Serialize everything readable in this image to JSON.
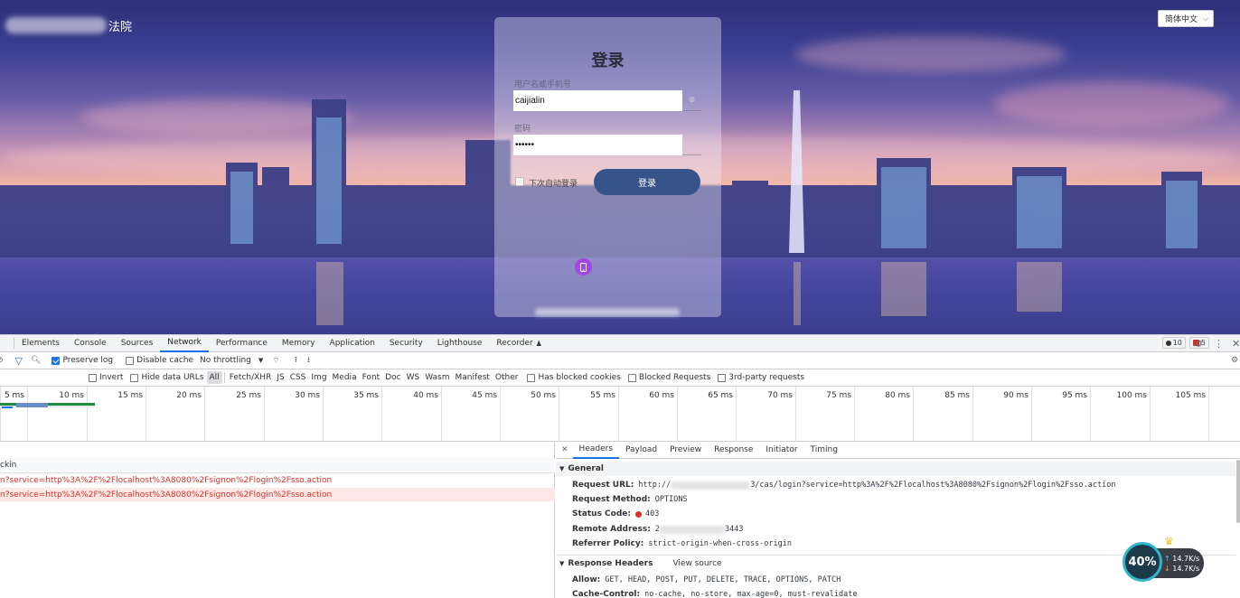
{
  "login_page": {
    "brand_text": "法院",
    "language": "简体中文",
    "title": "登录",
    "username_label": "用户名或手机号",
    "username_value": "caijialin",
    "password_label": "密码",
    "password_value": "••••••",
    "remember_label": "下次自动登录",
    "login_button": "登录",
    "phone_icon": "mobile-phone-icon"
  },
  "devtools": {
    "tabs": [
      "Elements",
      "Console",
      "Sources",
      "Network",
      "Performance",
      "Memory",
      "Application",
      "Security",
      "Lighthouse",
      "Recorder"
    ],
    "active_tab": "Network",
    "message_count": "10",
    "error_count": "5",
    "toolbar": {
      "preserve_log": "Preserve log",
      "disable_cache": "Disable cache",
      "throttling": "No throttling"
    },
    "filters": {
      "invert": "Invert",
      "hide_data_urls": "Hide data URLs",
      "types": [
        "All",
        "Fetch/XHR",
        "JS",
        "CSS",
        "Img",
        "Media",
        "Font",
        "Doc",
        "WS",
        "Wasm",
        "Manifest",
        "Other"
      ],
      "has_blocked_cookies": "Has blocked cookies",
      "blocked_requests": "Blocked Requests",
      "third_party": "3rd-party requests"
    },
    "timeline_ticks": [
      "5 ms",
      "10 ms",
      "15 ms",
      "20 ms",
      "25 ms",
      "30 ms",
      "35 ms",
      "40 ms",
      "45 ms",
      "50 ms",
      "55 ms",
      "60 ms",
      "65 ms",
      "70 ms",
      "75 ms",
      "80 ms",
      "85 ms",
      "90 ms",
      "95 ms",
      "100 ms",
      "105 ms"
    ],
    "list": {
      "header": "ckin",
      "rows": [
        "n?service=http%3A%2F%2Flocalhost%3A8080%2Fsignon%2Flogin%2Fsso.action",
        "n?service=http%3A%2F%2Flocalhost%3A8080%2Fsignon%2Flogin%2Fsso.action"
      ]
    },
    "details": {
      "tabs": [
        "Headers",
        "Payload",
        "Preview",
        "Response",
        "Initiator",
        "Timing"
      ],
      "general_title": "General",
      "request_url_label": "Request URL:",
      "request_url_prefix": "http://",
      "request_url_suffix": "3/cas/login?service=http%3A%2F%2Flocalhost%3A8080%2Fsignon%2Flogin%2Fsso.action",
      "request_method_label": "Request Method:",
      "request_method": "OPTIONS",
      "status_code_label": "Status Code:",
      "status_code": "403",
      "remote_address_label": "Remote Address:",
      "remote_address_prefix": "2",
      "remote_address_suffix": "3443",
      "referrer_policy_label": "Referrer Policy:",
      "referrer_policy": "strict-origin-when-cross-origin",
      "response_headers_title": "Response Headers",
      "view_source": "View source",
      "allow_label": "Allow:",
      "allow": "GET, HEAD, POST, PUT, DELETE, TRACE, OPTIONS, PATCH",
      "cache_control_label": "Cache-Control:",
      "cache_control": "no-cache, no-store, max-age=0, must-revalidate"
    }
  },
  "speed_widget": {
    "percent": "40%",
    "upload": "14.7K/s",
    "download": "14.7K/s"
  },
  "colors": {
    "login_button": "#36548a",
    "devtools_accent": "#1a73e8",
    "error_red": "#d93025",
    "selected_row": "#fce8e6"
  }
}
